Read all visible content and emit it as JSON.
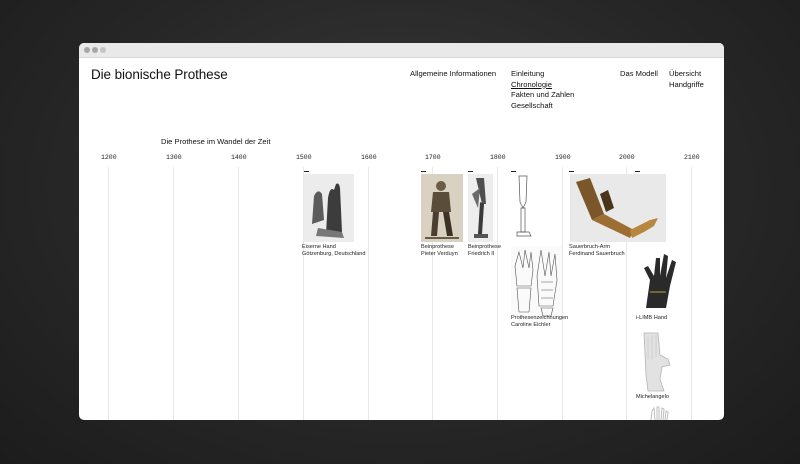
{
  "window": {
    "title": "Die bionische Prothese"
  },
  "nav": {
    "col1": [
      "Allgemeine Informationen"
    ],
    "col2": [
      "Einleitung",
      "Chronologie",
      "Fakten und Zahlen",
      "Gesellschaft"
    ],
    "col3": [
      "Das Modell"
    ],
    "col4": [
      "Übersicht",
      "Handgriffe"
    ],
    "active": "Chronologie"
  },
  "timeline": {
    "heading": "Die Prothese im Wandel der Zeit",
    "years": [
      "1200",
      "1300",
      "1400",
      "1500",
      "1600",
      "1700",
      "1800",
      "1900",
      "2000",
      "2100"
    ],
    "items": [
      {
        "line1": "Eiserne Hand",
        "line2": "Götzenburg, Deutschland"
      },
      {
        "line1": "Beinprothese",
        "line2": "Pieter Verduyn"
      },
      {
        "line1": "Beinprothese",
        "line2": "Friedrich II"
      },
      {
        "line1": "Prothesenzeichnungen",
        "line2": "Caroline Eichler"
      },
      {
        "line1": "Sauerbruch-Arm",
        "line2": "Ferdinand Sauerbruch"
      },
      {
        "line1": "i-LIMB Hand",
        "line2": ""
      },
      {
        "line1": "Michelangelo",
        "line2": ""
      }
    ]
  },
  "colors": {
    "background": "#262626",
    "window": "#ffffff",
    "text": "#111111",
    "gridline": "#e8e8e8"
  }
}
